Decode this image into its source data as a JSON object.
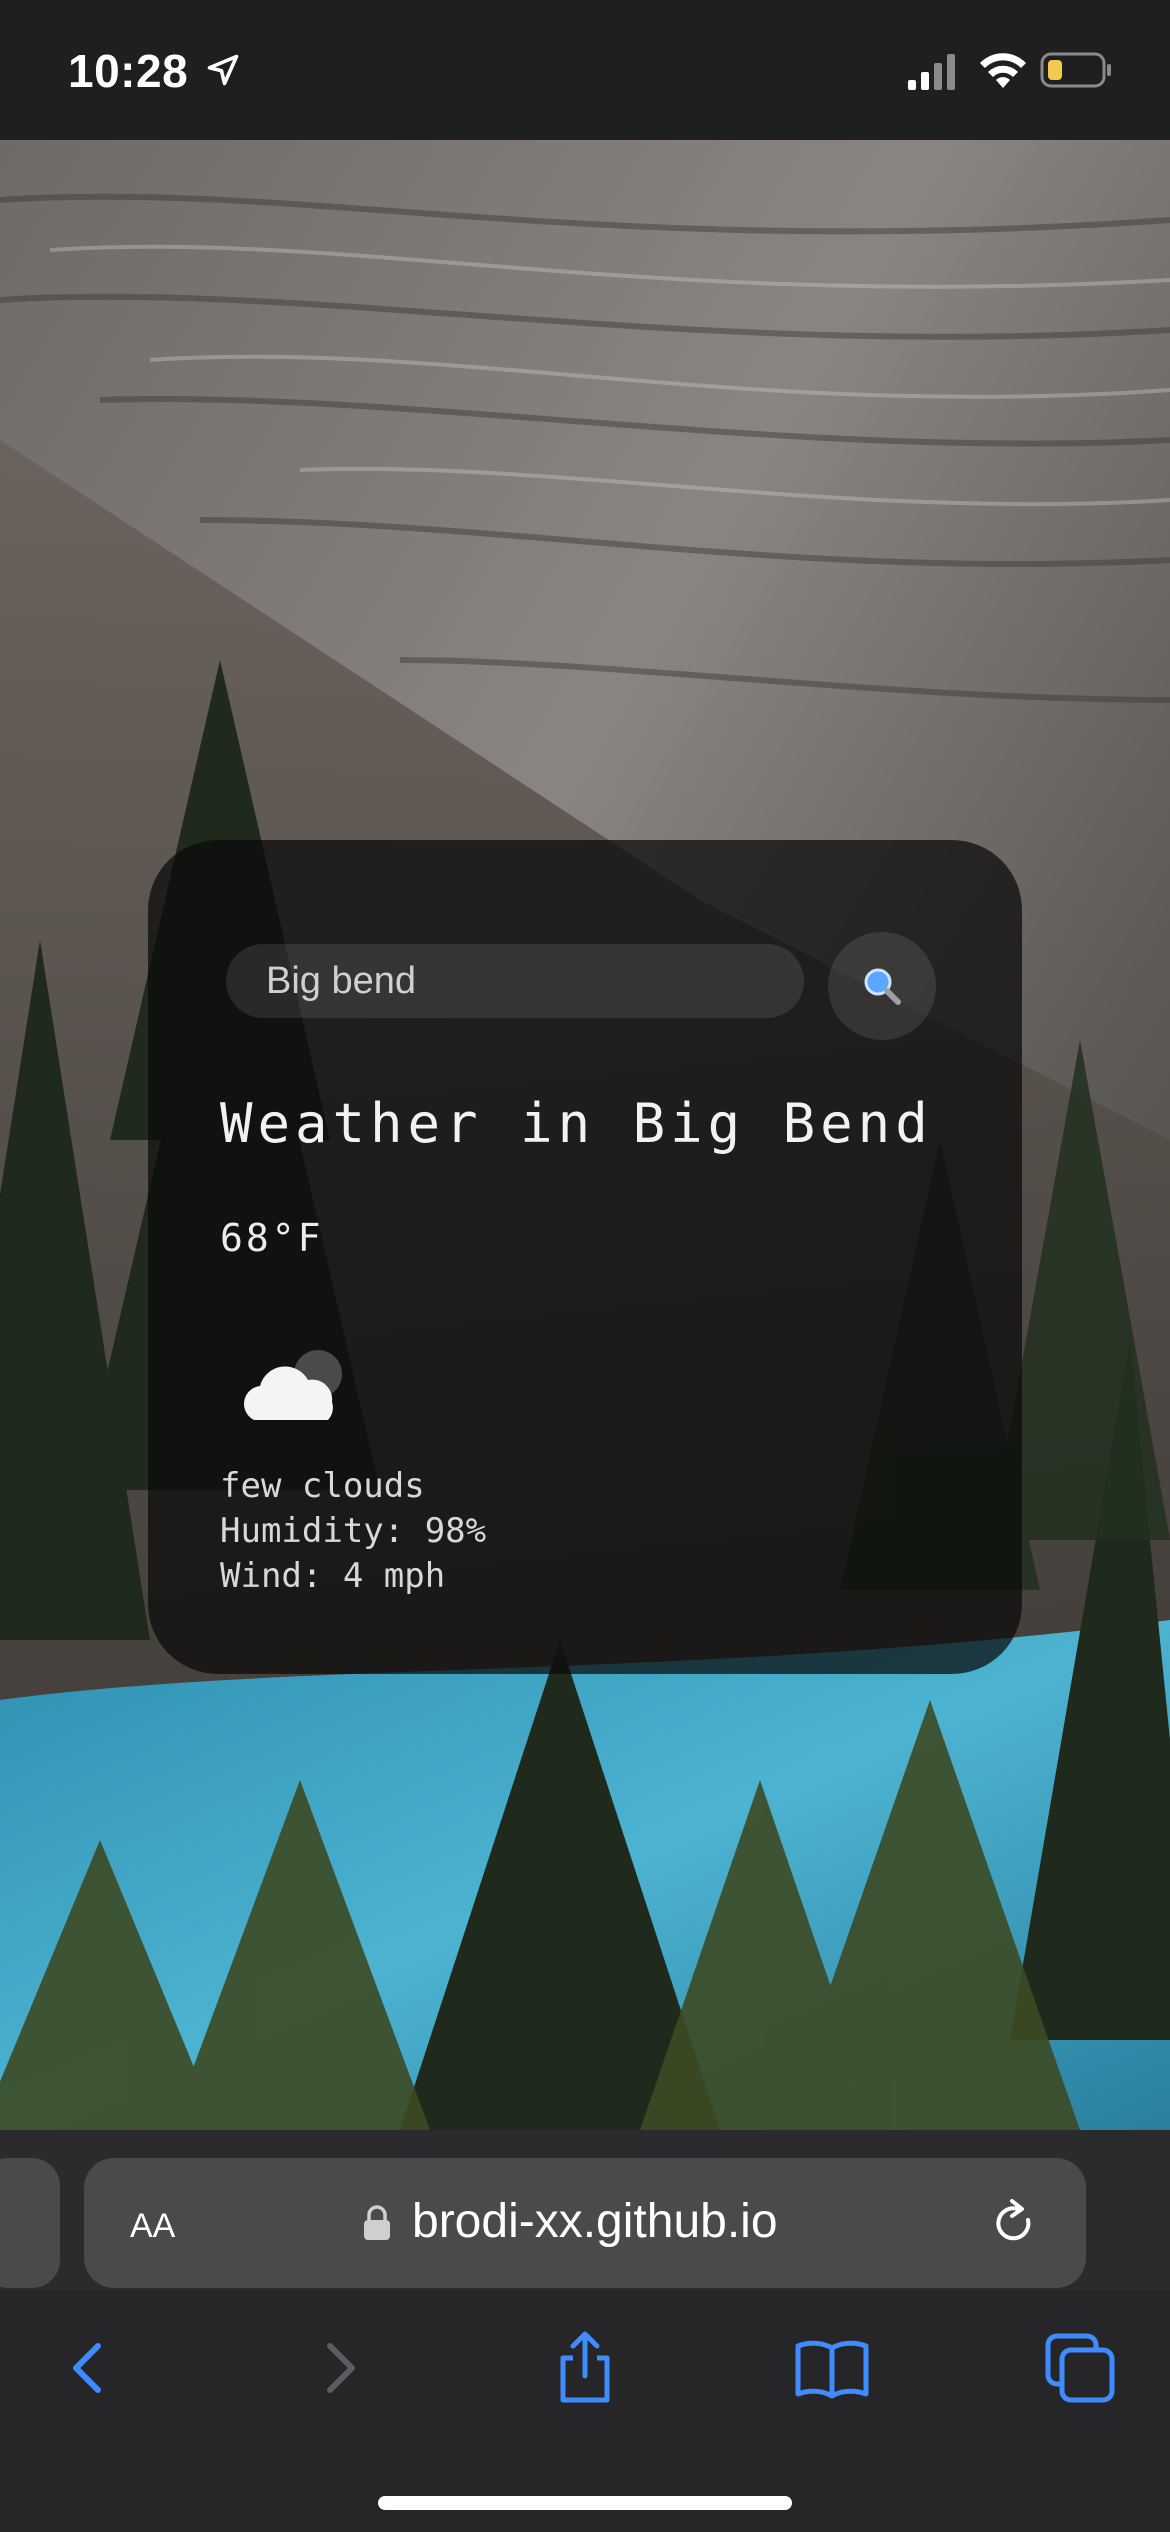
{
  "status_bar": {
    "time": "10:28",
    "icons": [
      "location-arrow-icon",
      "cellular-signal-icon",
      "wifi-icon",
      "battery-low-icon"
    ],
    "battery_color": "#f2c94c"
  },
  "weather_card": {
    "search": {
      "value": "Big bend",
      "icon": "search-icon"
    },
    "city_heading": "Weather in Big Bend",
    "temperature": "68°F",
    "condition_icon": "few-clouds-icon",
    "description": "few clouds",
    "humidity": "Humidity: 98%",
    "wind": "Wind: 4 mph"
  },
  "browser": {
    "reader_button": "AA",
    "url": "brodi-xx.github.io",
    "accent_color": "#3f8cff",
    "toolbar": [
      "back-icon",
      "forward-icon",
      "share-icon",
      "bookmarks-icon",
      "tabs-icon"
    ]
  }
}
